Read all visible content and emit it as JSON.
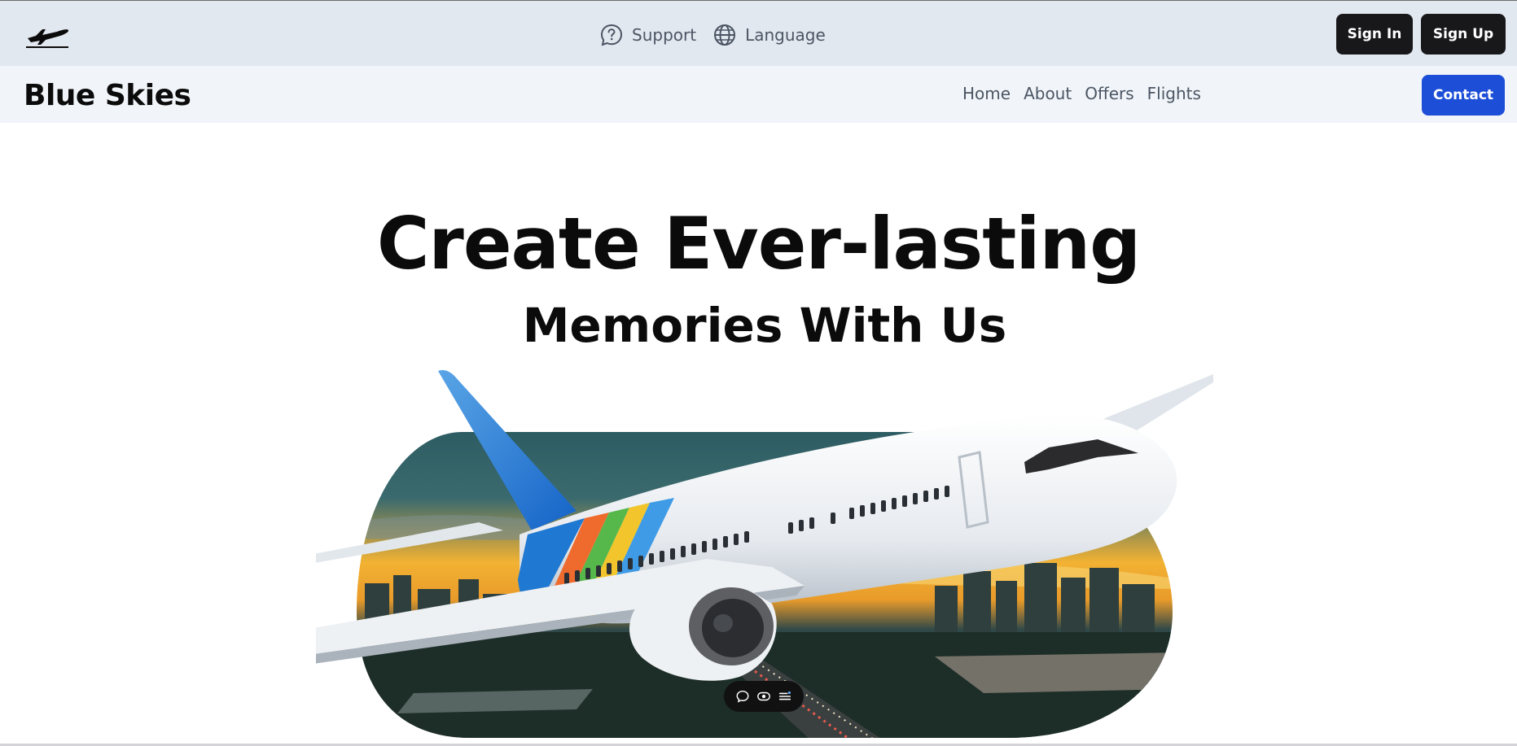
{
  "topbar": {
    "support_label": "Support",
    "language_label": "Language",
    "signin_label": "Sign In",
    "signup_label": "Sign Up"
  },
  "navbar": {
    "brand": "Blue Skies",
    "links": [
      "Home",
      "About",
      "Offers",
      "Flights"
    ],
    "contact_label": "Contact"
  },
  "hero": {
    "title": "Create Ever-lasting",
    "subtitle": "Memories With Us"
  },
  "icons": {
    "logo": "airplane-logo-icon",
    "support": "question-bubble-icon",
    "language": "globe-icon",
    "toolbar": [
      "chat-icon",
      "eye-icon",
      "menu-icon"
    ]
  },
  "colors": {
    "topbar_bg": "#e2e8f0",
    "navbar_bg": "#f1f5f9",
    "button_dark": "#18181b",
    "button_primary": "#1d4ed8"
  }
}
